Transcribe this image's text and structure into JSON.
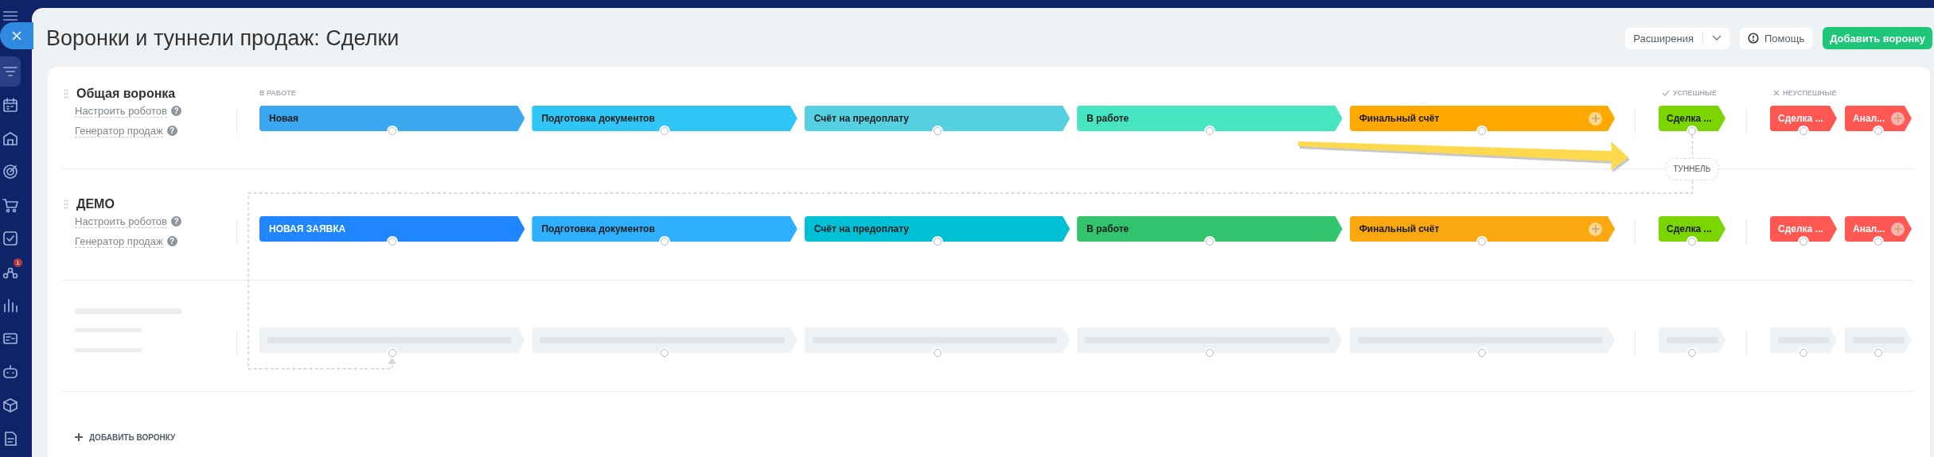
{
  "sidebar": {
    "items": [
      {
        "kind": "filter",
        "selected": true
      },
      {
        "kind": "calendar",
        "selected": false
      },
      {
        "kind": "store",
        "selected": false
      },
      {
        "kind": "target",
        "selected": false
      },
      {
        "kind": "cart",
        "selected": false
      },
      {
        "kind": "task",
        "selected": false
      },
      {
        "kind": "flow",
        "selected": false,
        "badge": "1"
      },
      {
        "kind": "chart",
        "selected": false
      },
      {
        "kind": "cards",
        "selected": false
      },
      {
        "kind": "robot",
        "selected": false
      },
      {
        "kind": "box",
        "selected": false
      },
      {
        "kind": "document",
        "selected": false
      }
    ]
  },
  "title": "Воронки и туннели продаж: Сделки",
  "toolbar": {
    "extensions": "Расширения",
    "help": "Помощь",
    "add_funnel": "Добавить воронку"
  },
  "group_labels": {
    "in_work": "В РАБОТЕ",
    "success": "УСПЕШНЫЕ",
    "failure": "НЕУСПЕШНЫЕ"
  },
  "funnels": [
    {
      "kind": "funnel",
      "name": "Общая воронка",
      "links": [
        {
          "label": "Настроить роботов",
          "hint": "?"
        },
        {
          "label": "Генератор продаж",
          "hint": "?"
        }
      ],
      "in_work": [
        {
          "label": "Новая",
          "color": "#39a8ef"
        },
        {
          "label": "Подготовка документов",
          "color": "#2fc6f6"
        },
        {
          "label": "Счёт на предоплату",
          "color": "#55d0e0"
        },
        {
          "label": "В работе",
          "color": "#47e4c2"
        },
        {
          "label": "Финальный счёт",
          "color": "#ffa900",
          "add_button": true
        }
      ],
      "success": [
        {
          "label": "Сделка ...",
          "color": "#7bd500"
        }
      ],
      "failure": [
        {
          "label": "Сделка ...",
          "color": "#ff5752"
        },
        {
          "label": "Анал...",
          "color": "#ff5752",
          "add_button": true
        }
      ]
    },
    {
      "kind": "funnel",
      "name": "ДЕМО",
      "links": [
        {
          "label": "Настроить роботов",
          "hint": "?"
        },
        {
          "label": "Генератор продаж",
          "hint": "?"
        }
      ],
      "in_work": [
        {
          "label": "НОВАЯ ЗАЯВКА",
          "color": "#1f86ff"
        },
        {
          "label": "Подготовка документов",
          "color": "#2fb0ff"
        },
        {
          "label": "Счёт на предоплату",
          "color": "#00c0d5"
        },
        {
          "label": "В работе",
          "color": "#32c46c"
        },
        {
          "label": "Финальный счёт",
          "color": "#f9a90f",
          "add_button": true
        }
      ],
      "success": [
        {
          "label": "Сделка ...",
          "color": "#7bd500"
        }
      ],
      "failure": [
        {
          "label": "Сделка ...",
          "color": "#ff5752"
        },
        {
          "label": "Анал...",
          "color": "#ff5752",
          "add_button": true
        }
      ]
    },
    {
      "kind": "skeleton"
    }
  ],
  "tunnel": {
    "label": "ТУННЕЛЬ"
  },
  "add_funnel": "ДОБАВИТЬ ВОРОНКУ"
}
